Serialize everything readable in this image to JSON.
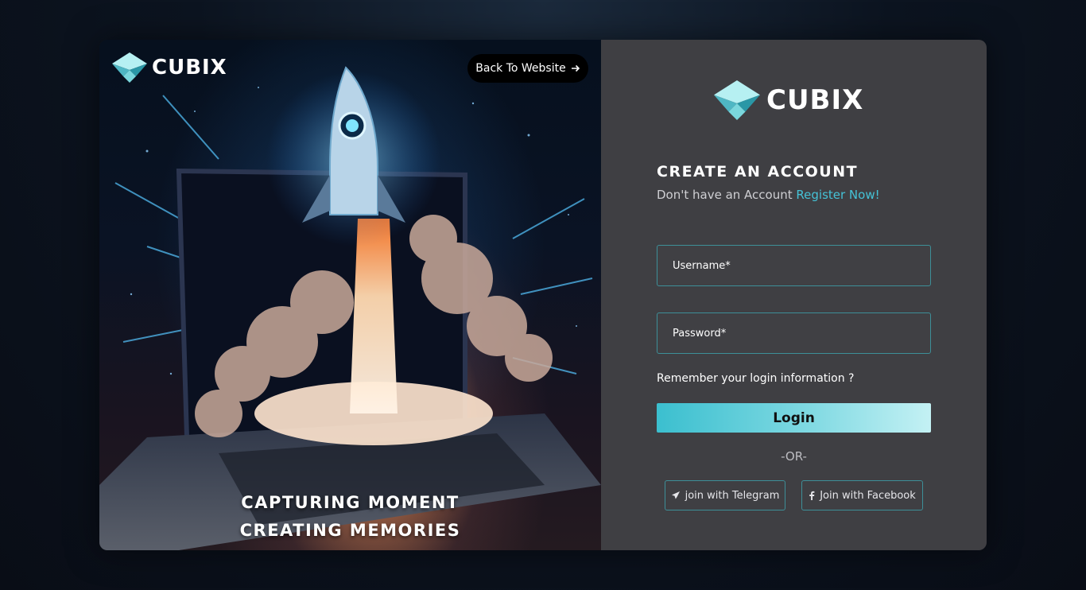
{
  "hero": {
    "brand_name": "CUBIX",
    "back_button_label": "Back To Website",
    "back_icon": "arrow-right-icon",
    "tagline_line1": "CAPTURING MOMENT",
    "tagline_line2": "CREATING MEMORIES"
  },
  "form": {
    "brand_name": "CUBIX",
    "heading": "CREATE AN ACCOUNT",
    "subline_text": "Don't have an Account",
    "register_link": "Register Now!",
    "username_placeholder": "Username*",
    "password_placeholder": "Password*",
    "remember_text": "Remember your login information ?",
    "login_label": "Login",
    "or_text": "-OR-",
    "telegram_label": "join with Telegram",
    "facebook_label": "Join with Facebook"
  },
  "colors": {
    "accent": "#45c2d6",
    "panel": "#3f3f43",
    "border": "#3d8f98"
  }
}
